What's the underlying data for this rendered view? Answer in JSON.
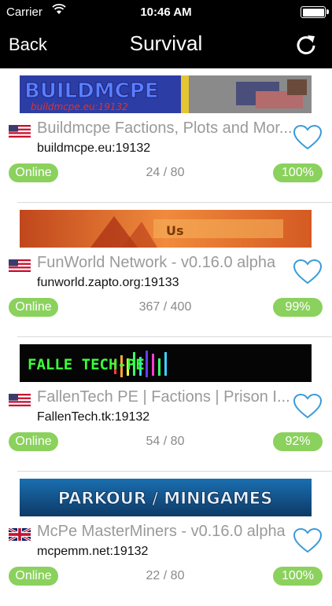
{
  "status_bar": {
    "carrier": "Carrier",
    "time": "10:46 AM"
  },
  "nav": {
    "back": "Back",
    "title": "Survival",
    "refresh_icon": "refresh-icon"
  },
  "colors": {
    "accent_green": "#8bd15d",
    "nav_bg": "#000000",
    "name_gray": "#9a9a9a"
  },
  "servers": [
    {
      "banner_text": "BUILDMCPE",
      "banner_subtext": "buildmcpe.eu:19132",
      "flag": "us-flag-icon",
      "name": "Buildmcpe Factions, Plots and Mor...",
      "host": "buildmcpe.eu:19132",
      "status": "Online",
      "players": "24 / 80",
      "percent": "100%"
    },
    {
      "banner_text": "Us",
      "banner_subtext": "",
      "flag": "us-flag-icon",
      "name": "FunWorld Network - v0.16.0 alpha",
      "host": "funworld.zapto.org:19133",
      "status": "Online",
      "players": "367 / 400",
      "percent": "99%"
    },
    {
      "banner_text": "FALLE TECH-PE",
      "banner_subtext": "",
      "flag": "us-flag-icon",
      "name": "FallenTech PE | Factions | Prison I...",
      "host": "FallenTech.tk:19132",
      "status": "Online",
      "players": "54 / 80",
      "percent": "92%"
    },
    {
      "banner_text": "PARKOUR / MINIGAMES",
      "banner_subtext": "",
      "flag": "uk-flag-icon",
      "name": "McPe MasterMiners - v0.16.0 alpha",
      "host": "mcpemm.net:19132",
      "status": "Online",
      "players": "22 / 80",
      "percent": "100%"
    }
  ]
}
